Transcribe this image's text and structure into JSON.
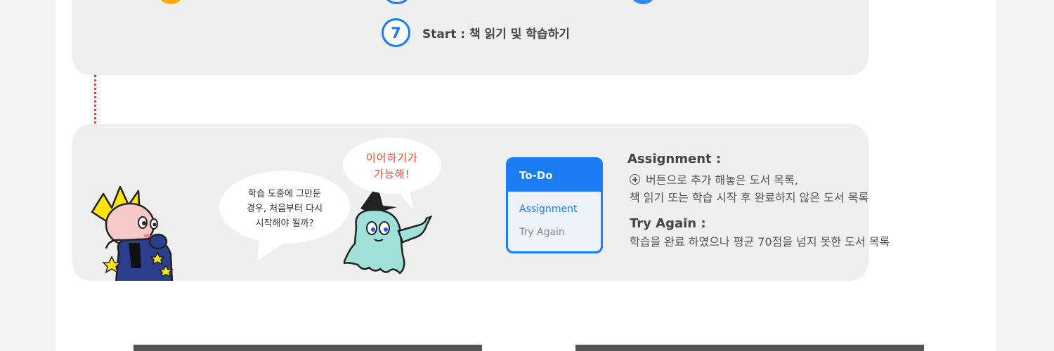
{
  "step": {
    "number": "7",
    "text": "Start : 책 읽기 및 학습하기"
  },
  "bubbles": {
    "kid": [
      "학습 도중에 그만둔",
      "경우, 처음부터 다시",
      "시작해야 될까?"
    ],
    "ghost": [
      "이어하기가",
      "가능해!"
    ]
  },
  "todo": {
    "header": "To-Do",
    "assignment": "Assignment",
    "try_again": "Try Again"
  },
  "info": {
    "assignment_title": "Assignment :",
    "assignment_line1": "버튼으로 추가 해놓은 도서 목록,",
    "assignment_line2": "책 읽기 또는 학습 시작 후 완료하지 않은 도서 목록",
    "try_again_title": "Try Again :",
    "try_again_line": "학습을 완료 하였으나 평균 70점을 넘지 못한 도서 목록"
  },
  "colors": {
    "accent_blue": "#1a7cf5",
    "dot_red": "#e0473c",
    "panel_gray": "#efefef"
  }
}
